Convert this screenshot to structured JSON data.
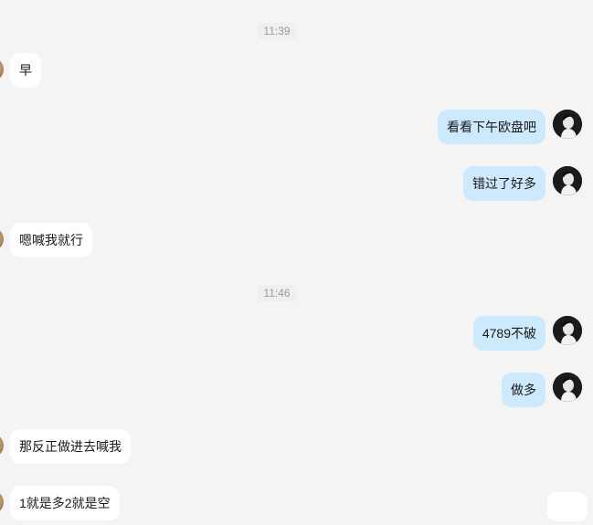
{
  "conversation": {
    "timestamps": [
      "11:39",
      "11:46"
    ],
    "messages": [
      {
        "side": "left",
        "text": "早"
      },
      {
        "side": "right",
        "text": "看看下午欧盘吧"
      },
      {
        "side": "right",
        "text": "错过了好多"
      },
      {
        "side": "left",
        "text": "嗯喊我就行"
      },
      {
        "side": "right",
        "text": "4789不破"
      },
      {
        "side": "right",
        "text": "做多"
      },
      {
        "side": "left",
        "text": "那反正做进去喊我"
      },
      {
        "side": "left",
        "text": "1就是多2就是空"
      }
    ]
  },
  "colors": {
    "background": "#f4f4f4",
    "incoming_bubble": "#ffffff",
    "outgoing_bubble": "#cde9fd",
    "timestamp_text": "#9a9a9a"
  },
  "icons": {
    "self_avatar": "user-avatar-icon",
    "peer_avatar": "contact-avatar-icon"
  }
}
